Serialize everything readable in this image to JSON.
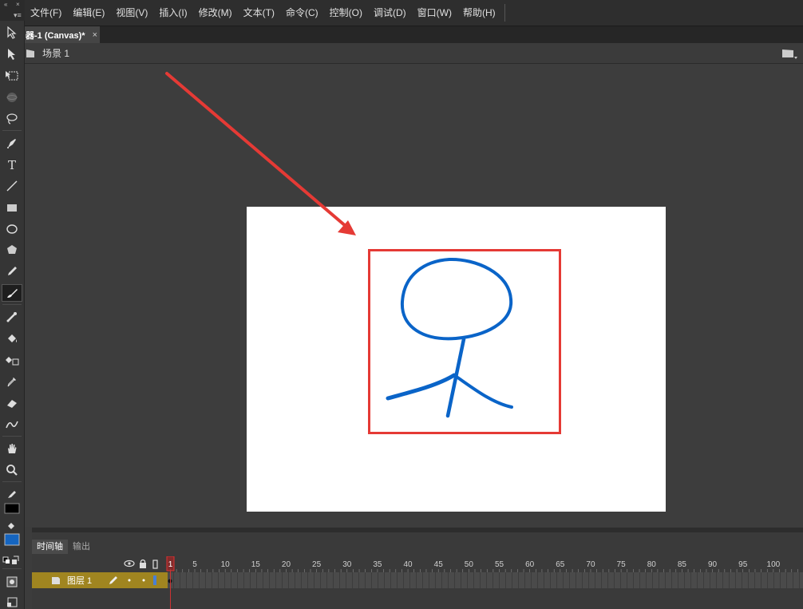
{
  "menu": [
    "文件(F)",
    "编辑(E)",
    "视图(V)",
    "插入(I)",
    "修改(M)",
    "文本(T)",
    "命令(C)",
    "控制(O)",
    "调试(D)",
    "窗口(W)",
    "帮助(H)"
  ],
  "document_tab": {
    "title": "器-1 (Canvas)*",
    "close": "×"
  },
  "scene": {
    "label": "场景 1"
  },
  "timeline": {
    "tabs": [
      "时间轴",
      "输出"
    ],
    "layer": {
      "name": "图层 1"
    },
    "frame_numbers": [
      "1",
      "5",
      "10",
      "15",
      "20",
      "25",
      "30",
      "35",
      "40",
      "45",
      "50",
      "55",
      "60",
      "65",
      "70",
      "75",
      "80",
      "85",
      "90",
      "95",
      "100"
    ],
    "current_frame": 1
  },
  "colors": {
    "stroke_color": "#1565c0",
    "fill_color": "#000000",
    "annotation_red": "#e53a35",
    "drawing_blue": "#0a64c8"
  },
  "tools": [
    "selection-icon",
    "subselection-icon",
    "free-transform-icon",
    "3d-rotation-icon",
    "lasso-icon",
    "pen-icon",
    "text-icon",
    "line-icon",
    "rectangle-icon",
    "oval-icon",
    "polystar-icon",
    "pencil-icon",
    "brush-icon",
    "bone-icon",
    "paint-bucket-icon",
    "ink-bottle-icon",
    "eyedropper-icon",
    "eraser-icon",
    "width-icon",
    "hand-icon",
    "zoom-icon"
  ]
}
